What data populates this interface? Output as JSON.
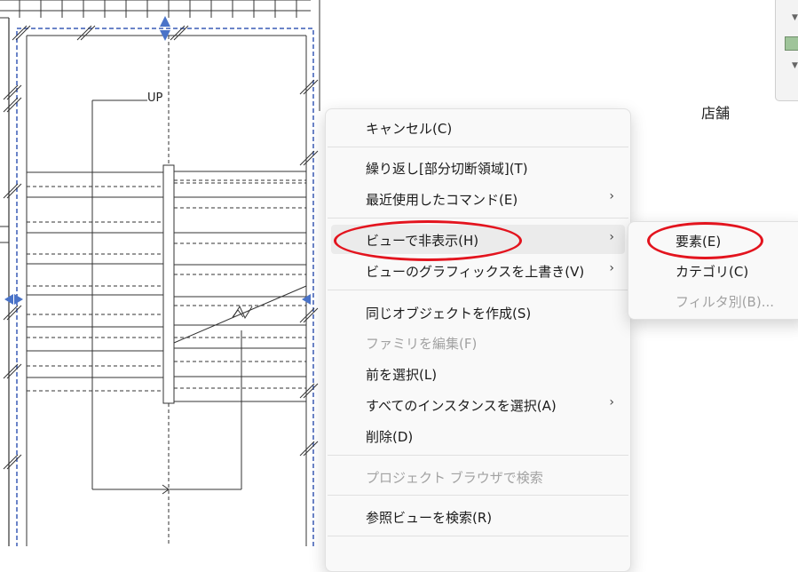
{
  "canvas": {
    "room_label": "店舗",
    "stair_label": "UP"
  },
  "context_menu": {
    "items": [
      {
        "label": "キャンセル(C)",
        "disabled": false,
        "submenu": false
      },
      {
        "label": "繰り返し[部分切断領域](T)",
        "disabled": false,
        "submenu": false
      },
      {
        "label": "最近使用したコマンド(E)",
        "disabled": false,
        "submenu": true
      },
      {
        "label": "ビューで非表示(H)",
        "disabled": false,
        "submenu": true,
        "highlighted": true
      },
      {
        "label": "ビューのグラフィックスを上書き(V)",
        "disabled": false,
        "submenu": true
      },
      {
        "label": "同じオブジェクトを作成(S)",
        "disabled": false,
        "submenu": false
      },
      {
        "label": "ファミリを編集(F)",
        "disabled": true,
        "submenu": false
      },
      {
        "label": "前を選択(L)",
        "disabled": false,
        "submenu": false
      },
      {
        "label": "すべてのインスタンスを選択(A)",
        "disabled": false,
        "submenu": true
      },
      {
        "label": "削除(D)",
        "disabled": false,
        "submenu": false
      },
      {
        "label": "プロジェクト ブラウザで検索",
        "disabled": true,
        "submenu": false
      },
      {
        "label": "参照ビューを検索(R)",
        "disabled": false,
        "submenu": false
      }
    ],
    "chevron": "›"
  },
  "submenu": {
    "items": [
      {
        "label": "要素(E)",
        "disabled": false
      },
      {
        "label": "カテゴリ(C)",
        "disabled": false
      },
      {
        "label": "フィルタ別(B)...",
        "disabled": true
      }
    ]
  },
  "colors": {
    "selection_dash": "#3a5bb5",
    "grip": "#4a73c8",
    "annotation": "#e3141e",
    "menu_bg": "#f9f9f9"
  }
}
